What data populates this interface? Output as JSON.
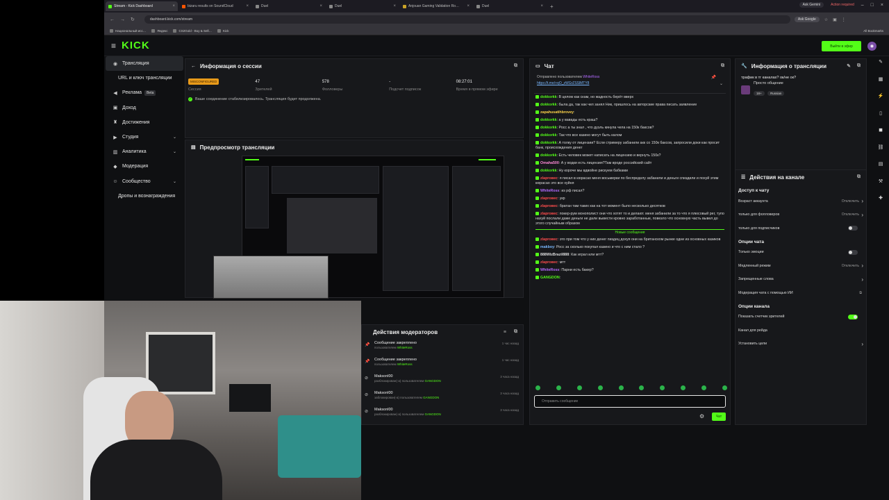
{
  "browser": {
    "tabs": [
      {
        "label": "Stream - Kick Dashboard",
        "active": true,
        "color": "#53fc18"
      },
      {
        "label": "bizaru results on SoundCloud",
        "active": false,
        "color": "#ff5500"
      },
      {
        "label": "Duel",
        "active": false,
        "color": "#888888"
      },
      {
        "label": "Duel",
        "active": false,
        "color": "#888888"
      },
      {
        "label": "Anjouan Gaming Validation Ro…",
        "active": false,
        "color": "#c9a227"
      },
      {
        "label": "Duel",
        "active": false,
        "color": "#888888"
      }
    ],
    "ask_gemini": "Ask Gemini",
    "action_required": "Action required",
    "url": "dashboard.kick.com/stream",
    "ask_google": "Ask Google",
    "bookmarks": [
      "Национальный исс…",
      "Яндекс",
      "CS2Gold - Buy & Sell…",
      "Kick"
    ],
    "all_bookmarks": "All Bookmarks"
  },
  "header": {
    "logo": "KICK",
    "go_button": "Выйти в эфир"
  },
  "sidebar": {
    "items": [
      {
        "label": "Трансляция",
        "icon": "broadcast-icon",
        "active": true,
        "sub": false,
        "chevron": false
      },
      {
        "label": "URL и ключ трансляции",
        "icon": "",
        "active": false,
        "sub": true,
        "chevron": false
      },
      {
        "label": "Реклама",
        "icon": "megaphone-icon",
        "active": false,
        "sub": false,
        "chevron": false,
        "badge": "Beta"
      },
      {
        "label": "Доход",
        "icon": "wallet-icon",
        "active": false,
        "sub": false,
        "chevron": false
      },
      {
        "label": "Достижения",
        "icon": "trophy-icon",
        "active": false,
        "sub": false,
        "chevron": false
      },
      {
        "label": "Студия",
        "icon": "studio-icon",
        "active": false,
        "sub": false,
        "chevron": true
      },
      {
        "label": "Аналитика",
        "icon": "chart-icon",
        "active": false,
        "sub": false,
        "chevron": true
      },
      {
        "label": "Модерация",
        "icon": "shield-icon",
        "active": false,
        "sub": false,
        "chevron": false
      },
      {
        "label": "Сообщество",
        "icon": "community-icon",
        "active": false,
        "sub": false,
        "chevron": true
      },
      {
        "label": "Дропы и вознаграждения",
        "icon": "",
        "active": false,
        "sub": true,
        "chevron": false
      }
    ]
  },
  "session": {
    "title": "Информация о сессии",
    "stats": [
      {
        "value": "MISCONFIGURED",
        "label": "Сессия",
        "badge": true
      },
      {
        "value": "47",
        "label": "Зрителей"
      },
      {
        "value": "578",
        "label": "Фолловеры"
      },
      {
        "value": "-",
        "label": "Подсчет подписок"
      },
      {
        "value": "08:27:01",
        "label": "Время в прямом эфире"
      }
    ],
    "status": "Ваше соединение стабилизировалось. Трансляция будет продолжена."
  },
  "preview": {
    "title": "Предпросмотр трансляции"
  },
  "mod_actions": {
    "title": "Действия модераторов",
    "rows": [
      {
        "title": "Сообщение закреплено",
        "by": "пользователем",
        "user": "WhiteRoss",
        "time": "1 час назад",
        "icon": "pin-icon"
      },
      {
        "title": "Сообщение закреплено",
        "by": "пользователем",
        "user": "WhiteRoss",
        "time": "1 час назад",
        "icon": "pin-icon"
      },
      {
        "title": "Maksonl00",
        "by": "разблокирован(-а) пользователем",
        "user": "GANGDON",
        "time": "3 часа назад",
        "icon": "ban-icon"
      },
      {
        "title": "Maksonl00",
        "by": "заблокирован(-а) пользователем",
        "user": "GANGDON",
        "time": "3 часа назад",
        "icon": "ban-icon"
      },
      {
        "title": "Maksonl00",
        "by": "разблокирован(-а) пользователем",
        "user": "GANGDON",
        "time": "3 часа назад",
        "icon": "ban-icon"
      }
    ]
  },
  "chat": {
    "title": "Чат",
    "pinned_by": "Отправлено пользователем",
    "pinned_user": "WhiteRoss",
    "pinned_link": "https://t.me/+qO_zWGrZSSlMTY8",
    "messages": [
      {
        "user": "dokkorkk",
        "color": "#53fc18",
        "text": "В целом как скам, но жадность берёт вверх"
      },
      {
        "user": "dokkorkk",
        "color": "#53fc18",
        "text": "была да, так как чел занял Ник, пришлось на авторские права писать заявление"
      },
      {
        "user": "zapahusatihbrovey",
        "color": "#ffd54a",
        "text": ""
      },
      {
        "user": "dokkorkk",
        "color": "#53fc18",
        "text": "а у вавады есть краш?"
      },
      {
        "user": "dokkorkk",
        "color": "#53fc18",
        "text": "Росс а ты знал , что дуэль кинула чела на 150к баксов?"
      },
      {
        "user": "dokkorkk",
        "color": "#53fc18",
        "text": "Так что все казино могут быть калом"
      },
      {
        "user": "dokkorkk",
        "color": "#53fc18",
        "text": "А толку от лицензии? Если стримеру забанили акк со 150к баксов, запросили доки как просит банк, происхождения денег"
      },
      {
        "user": "dokkorkk",
        "color": "#53fc18",
        "text": "Есть человек может написать на лицензию и вернуть 150к?"
      },
      {
        "user": "Omaha500",
        "color": "#ff8ad8",
        "text": "А у водки есть лицензия?Там вроде российский сайт"
      },
      {
        "user": "dokkorkk",
        "color": "#53fc18",
        "text": "Ну короче мы вдвойне рискуем бабками"
      },
      {
        "user": "zlaproвec",
        "color": "#ff4d4d",
        "text": "я писал в кюрасао меня восьмерки по беспределу забанили и деньги спиздили и похуй этим кюрасао это все хуйня"
      },
      {
        "user": "WhiteRoss",
        "color": "#b36bff",
        "text": "из рф писал?"
      },
      {
        "user": "zlaproвec",
        "color": "#ff4d4d",
        "text": "укр"
      },
      {
        "user": "zlaproвec",
        "color": "#ff4d4d",
        "text": "братан там таких как на тот момент было несколько десятков"
      },
      {
        "user": "zlaproвec",
        "color": "#ff4d4d",
        "text": "покер-рум монополист они что хотят то и делают. меня забанили за то что я плюсовый рег, тупо нахуй послали даже деньги не дали вывести кровно заработанные, повезло что основную часть вывел до этого случайным образом"
      },
      {
        "user": "zlaproвec",
        "color": "#ff4d4d",
        "text": "это при том что у них денег пиздец дохуя они на британском рынке одни из основных казиков"
      },
      {
        "user": "makboy",
        "color": "#7ab8ff",
        "text": "Росс за сколько покупал казино и что с ним стало ?"
      },
      {
        "user": "888WizBrazil888",
        "color": "#ddd",
        "text": "Как играл или мтт?"
      },
      {
        "user": "zlaproвec",
        "color": "#ff4d4d",
        "text": "мтт"
      },
      {
        "user": "WhiteRoss",
        "color": "#b36bff",
        "text": "Парни есть бакер?"
      },
      {
        "user": "GANGDON",
        "color": "#53fc18",
        "text": ""
      }
    ],
    "new_messages": "Новые сообщения",
    "input_placeholder": "Отправить сообщение",
    "send": "Чат"
  },
  "stream_info": {
    "title": "Информация о трансляции",
    "stream_title": "трафик в тг каналах? ок/не ок?",
    "category": "Просто общение",
    "tags": [
      "18+",
      "Russian"
    ]
  },
  "channel_actions": {
    "title": "Действия на канале",
    "sections": [
      {
        "heading": "Доступ к чату",
        "rows": [
          {
            "label": "Возраст аккаунта",
            "value": "Отключить",
            "control": "chevron"
          },
          {
            "label": "только для фолловеров",
            "value": "Отключить",
            "control": "chevron"
          },
          {
            "label": "только для подписчиков",
            "value": "",
            "control": "toggle-off"
          }
        ]
      },
      {
        "heading": "Опции чата",
        "rows": [
          {
            "label": "Только эмоции",
            "value": "",
            "control": "toggle-off"
          },
          {
            "label": "Медленный режим",
            "value": "Отключить",
            "control": "chevron"
          },
          {
            "label": "Запрещенные слова",
            "value": "",
            "control": "chevron"
          },
          {
            "label": "Модерация чата с помощью ИИ",
            "value": "",
            "control": "external"
          }
        ]
      },
      {
        "heading": "Опции канала",
        "rows": [
          {
            "label": "Показать счетчик зрителей",
            "value": "",
            "control": "toggle-on"
          },
          {
            "label": "Канал для рейда",
            "value": "",
            "control": "none"
          },
          {
            "label": "Установить цели",
            "value": "",
            "control": "chevron"
          }
        ]
      }
    ]
  },
  "accent": "#53fc18"
}
